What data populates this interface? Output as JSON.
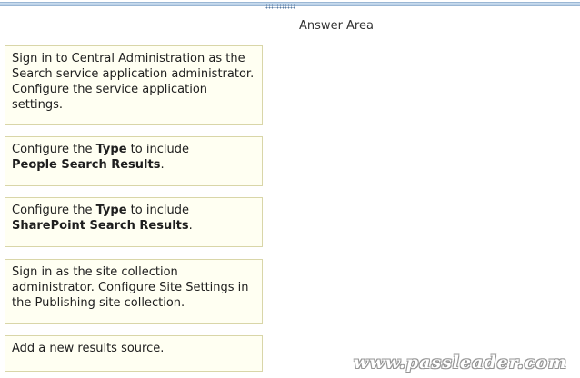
{
  "header": {
    "answer_area_title": "Answer Area"
  },
  "options": [
    {
      "parts": [
        {
          "text": "Sign in to Central Administration as the Search service application administrator. Configure the service application settings.",
          "bold": false
        }
      ]
    },
    {
      "parts": [
        {
          "text": "Configure the ",
          "bold": false
        },
        {
          "text": "Type",
          "bold": true
        },
        {
          "text": " to include ",
          "bold": false
        },
        {
          "text": "People Search Results",
          "bold": true
        },
        {
          "text": ".",
          "bold": false
        }
      ]
    },
    {
      "parts": [
        {
          "text": "Configure the ",
          "bold": false
        },
        {
          "text": "Type",
          "bold": true
        },
        {
          "text": " to include ",
          "bold": false
        },
        {
          "text": "SharePoint Search Results",
          "bold": true
        },
        {
          "text": ".",
          "bold": false
        }
      ]
    },
    {
      "parts": [
        {
          "text": "Sign in as the site collection administrator. Configure Site Settings in the Publishing site collection.",
          "bold": false
        }
      ]
    },
    {
      "parts": [
        {
          "text": "Add a new results source.",
          "bold": false
        }
      ]
    }
  ],
  "watermark": "www.passleader.com",
  "colors": {
    "box_background": "#fffff2",
    "box_border": "#d9d6a8",
    "stripe": "#a9c5e0"
  }
}
